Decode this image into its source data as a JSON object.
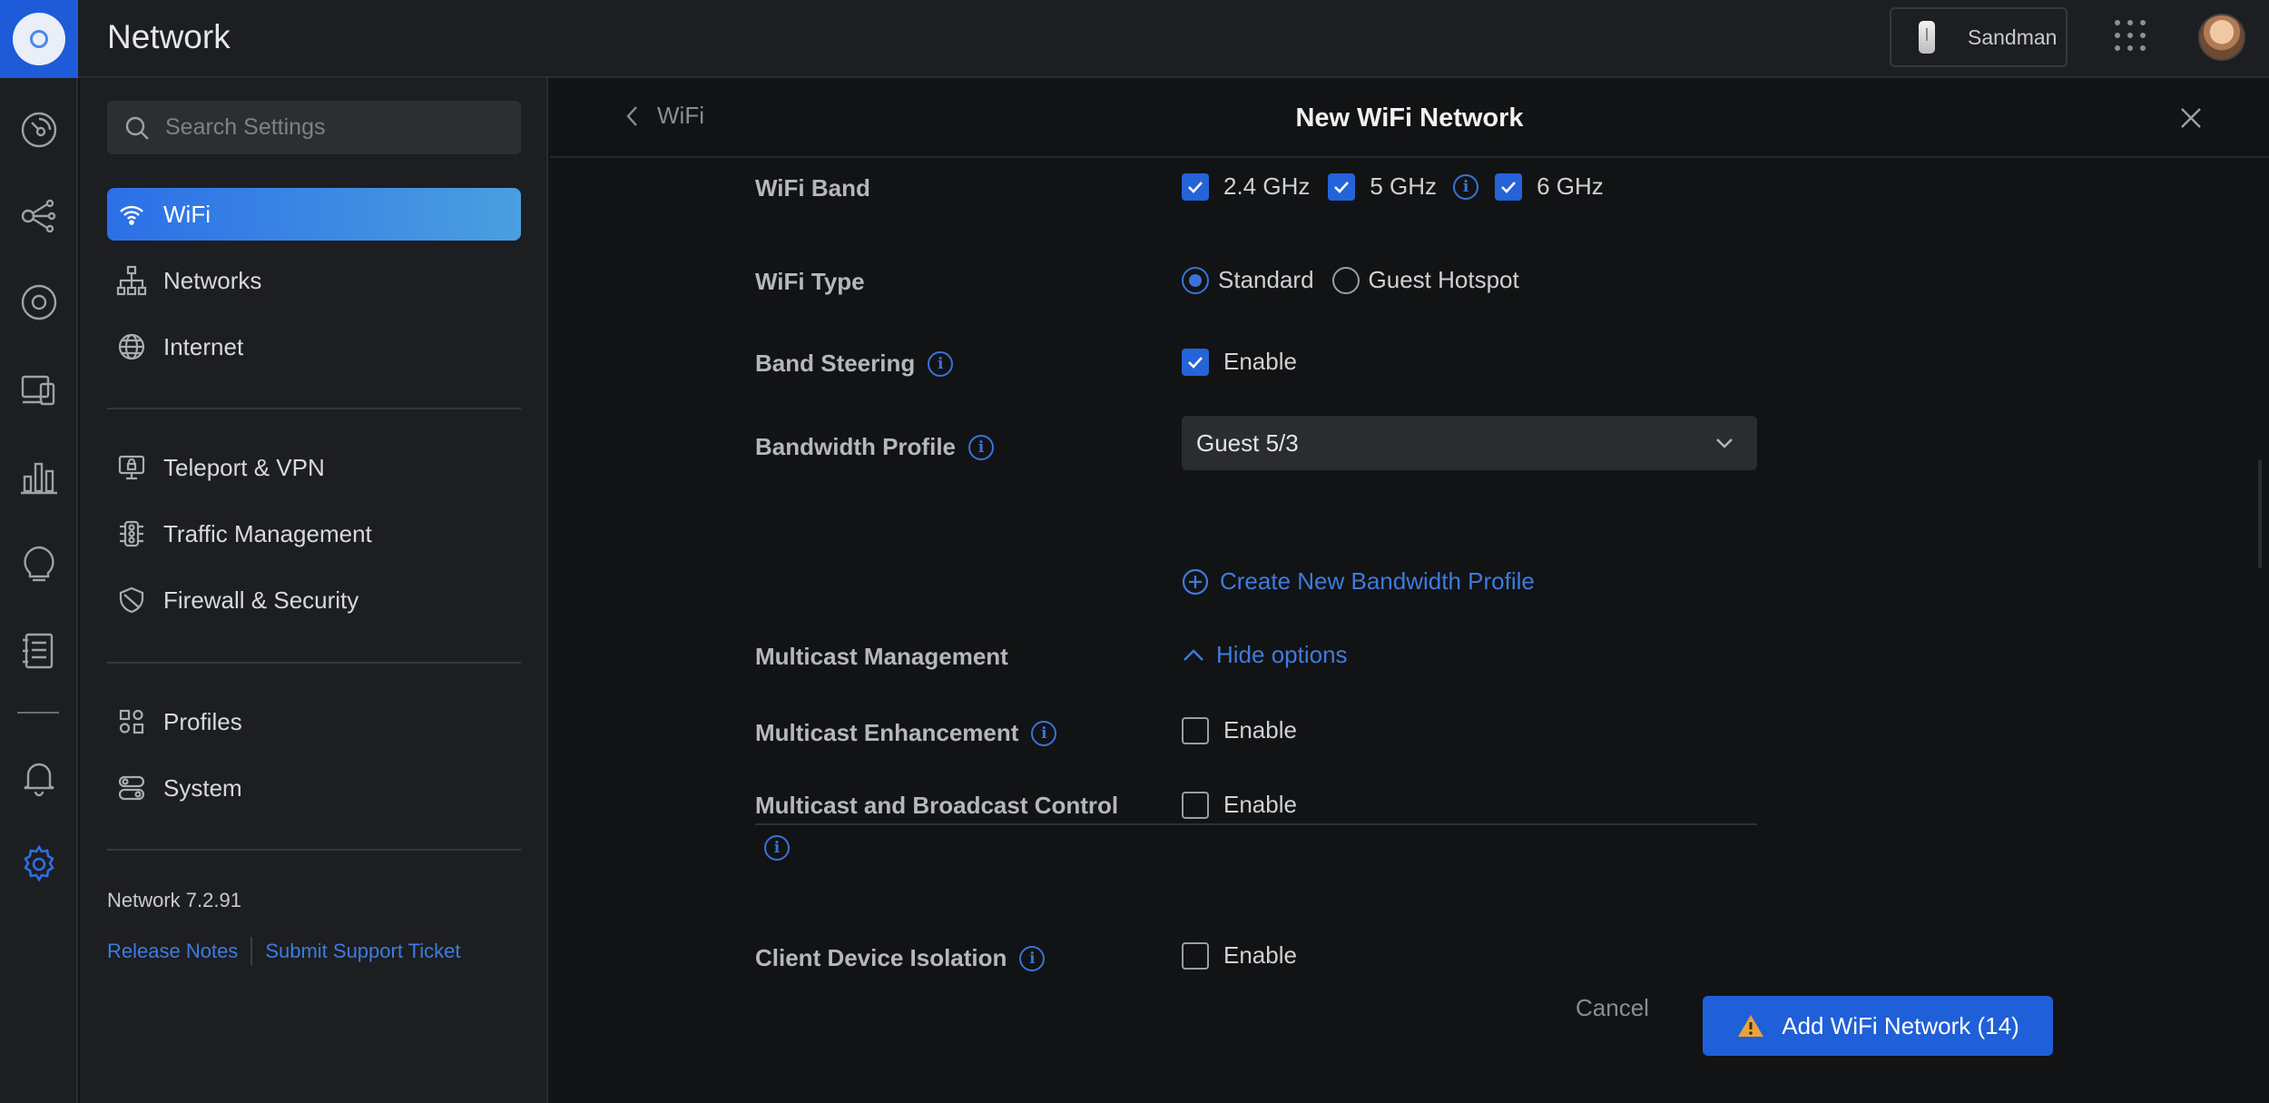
{
  "app": {
    "title": "Network"
  },
  "topbar": {
    "device_name": "Sandman"
  },
  "search": {
    "placeholder": "Search Settings"
  },
  "sidebar": {
    "items": [
      {
        "label": "WiFi",
        "icon": "wifi-icon",
        "active": true
      },
      {
        "label": "Networks",
        "icon": "network-tree-icon"
      },
      {
        "label": "Internet",
        "icon": "globe-icon"
      },
      {
        "label": "Teleport & VPN",
        "icon": "vpn-monitor-icon"
      },
      {
        "label": "Traffic Management",
        "icon": "traffic-icon"
      },
      {
        "label": "Firewall & Security",
        "icon": "shield-icon"
      },
      {
        "label": "Profiles",
        "icon": "profiles-grid-icon"
      },
      {
        "label": "System",
        "icon": "system-toggles-icon"
      }
    ],
    "version": "Network 7.2.91",
    "release_notes": "Release Notes",
    "support": "Submit Support Ticket"
  },
  "panel": {
    "back_label": "WiFi",
    "title": "New WiFi Network"
  },
  "form": {
    "wifi_band": {
      "label": "WiFi Band",
      "options": [
        {
          "label": "2.4 GHz",
          "checked": true
        },
        {
          "label": "5 GHz",
          "checked": true
        },
        {
          "label": "6 GHz",
          "checked": true
        }
      ]
    },
    "wifi_type": {
      "label": "WiFi Type",
      "options": [
        {
          "label": "Standard",
          "selected": true
        },
        {
          "label": "Guest Hotspot",
          "selected": false
        }
      ]
    },
    "band_steering": {
      "label": "Band Steering",
      "value_label": "Enable",
      "checked": true
    },
    "bandwidth_profile": {
      "label": "Bandwidth Profile",
      "value": "Guest 5/3",
      "create_link": "Create New Bandwidth Profile"
    },
    "multicast_management": {
      "label": "Multicast Management",
      "toggle_label": "Hide options"
    },
    "multicast_enhancement": {
      "label": "Multicast Enhancement",
      "value_label": "Enable",
      "checked": false
    },
    "multicast_broadcast_control": {
      "label": "Multicast and Broadcast Control",
      "value_label": "Enable",
      "checked": false
    },
    "client_device_isolation": {
      "label": "Client Device Isolation",
      "value_label": "Enable",
      "checked": false
    }
  },
  "footer": {
    "cancel": "Cancel",
    "submit": "Add WiFi Network (14)"
  },
  "colors": {
    "accent": "#1f5fd8",
    "warning": "#e8a33a"
  }
}
